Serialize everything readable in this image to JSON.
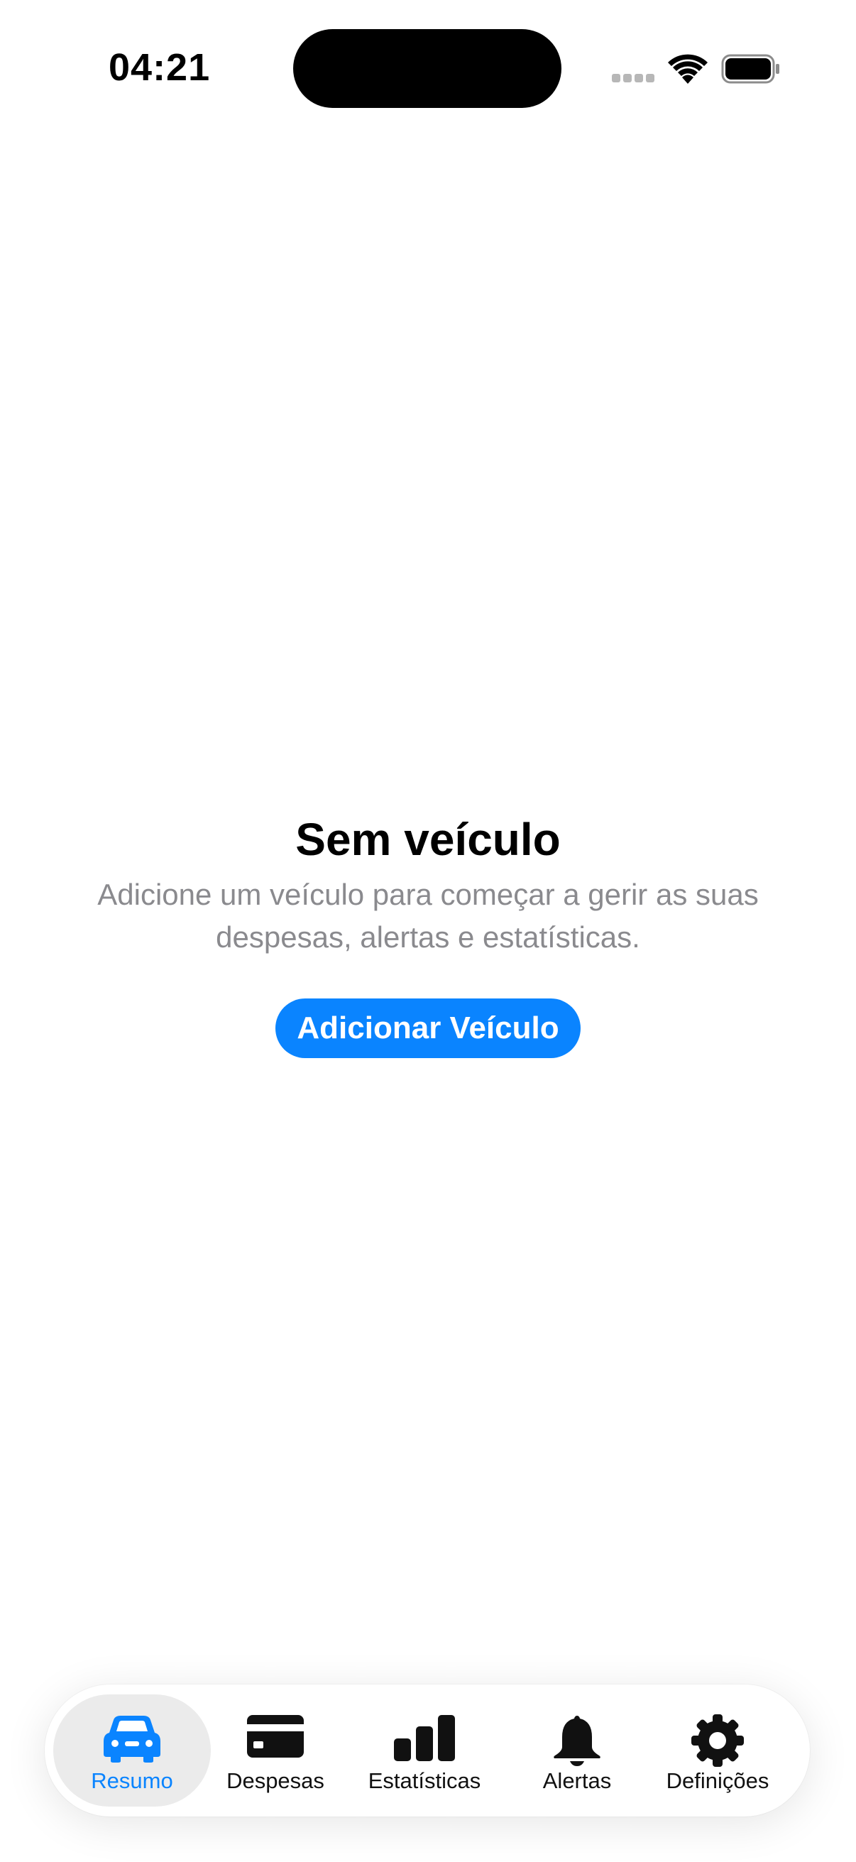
{
  "status_bar": {
    "time": "04:21"
  },
  "empty_state": {
    "title": "Sem veículo",
    "subtitle": "Adicione um veículo para começar a gerir as suas despesas, alertas e estatísticas.",
    "button_label": "Adicionar Veículo"
  },
  "tab_bar": {
    "tabs": [
      {
        "label": "Resumo",
        "icon": "car-icon",
        "active": true
      },
      {
        "label": "Despesas",
        "icon": "credit-card-icon",
        "active": false
      },
      {
        "label": "Estatísticas",
        "icon": "bar-chart-icon",
        "active": false
      },
      {
        "label": "Alertas",
        "icon": "bell-icon",
        "active": false
      },
      {
        "label": "Definições",
        "icon": "gear-icon",
        "active": false
      }
    ]
  },
  "colors": {
    "accent": "#0A84FF",
    "secondary_text": "#8A8A8E",
    "active_tab_background": "#EBEBEB"
  }
}
